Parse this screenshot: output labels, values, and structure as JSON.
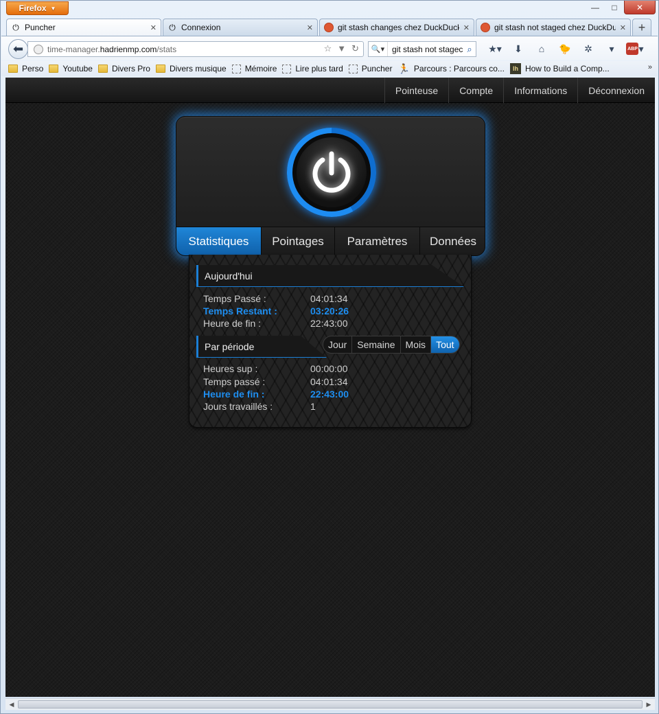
{
  "browser": {
    "menu_button": "Firefox",
    "window_controls": {
      "minimize": "—",
      "maximize": "□",
      "close": "✕"
    },
    "tabs": [
      {
        "title": "Puncher",
        "icon": "power-icon",
        "active": true
      },
      {
        "title": "Connexion",
        "icon": "power-icon",
        "active": false
      },
      {
        "title": "git stash changes chez DuckDuck...",
        "icon": "duckduckgo-icon",
        "active": false
      },
      {
        "title": "git stash not staged chez DuckDu...",
        "icon": "duckduckgo-icon",
        "active": false
      }
    ],
    "new_tab": "+",
    "url": {
      "prefix": "time-manager.",
      "host": "hadrienmp.com",
      "path": "/stats"
    },
    "search": {
      "value": "git stash not stagec"
    },
    "bookmarks": [
      {
        "label": "Perso",
        "icon": "folder"
      },
      {
        "label": "Youtube",
        "icon": "folder"
      },
      {
        "label": "Divers Pro",
        "icon": "folder"
      },
      {
        "label": "Divers musique",
        "icon": "folder"
      },
      {
        "label": "Mémoire",
        "icon": "dashed"
      },
      {
        "label": "Lire plus tard",
        "icon": "dashed"
      },
      {
        "label": "Puncher",
        "icon": "dashed"
      },
      {
        "label": "Parcours : Parcours co...",
        "icon": "runner"
      },
      {
        "label": "How to Build a Comp...",
        "icon": "lh"
      }
    ],
    "bookmarks_more": "»"
  },
  "site": {
    "nav": [
      "Pointeuse",
      "Compte",
      "Informations",
      "Déconnexion"
    ],
    "panel_tabs": [
      {
        "label": "Statistiques",
        "active": true
      },
      {
        "label": "Pointages",
        "active": false
      },
      {
        "label": "Paramètres",
        "active": false
      },
      {
        "label": "Données",
        "active": false
      }
    ],
    "today": {
      "title": "Aujourd'hui",
      "rows": [
        {
          "label": "Temps Passé :",
          "value": "04:01:34",
          "highlight": false
        },
        {
          "label": "Temps Restant :",
          "value": "03:20:26",
          "highlight": true
        },
        {
          "label": "Heure de fin :",
          "value": "22:43:00",
          "highlight": false
        }
      ]
    },
    "period": {
      "title": "Par période",
      "filters": [
        {
          "label": "Jour",
          "active": false
        },
        {
          "label": "Semaine",
          "active": false
        },
        {
          "label": "Mois",
          "active": false
        },
        {
          "label": "Tout",
          "active": true
        }
      ],
      "rows": [
        {
          "label": "Heures sup :",
          "value": "00:00:00",
          "highlight": false
        },
        {
          "label": "Temps passé :",
          "value": "04:01:34",
          "highlight": false
        },
        {
          "label": "Heure de fin :",
          "value": "22:43:00",
          "highlight": true
        },
        {
          "label": "Jours travaillés :",
          "value": "1",
          "highlight": false
        }
      ]
    },
    "colors": {
      "accent": "#1e8ef0",
      "active_tab": "#1570c0",
      "background": "#1c1c1c"
    }
  }
}
